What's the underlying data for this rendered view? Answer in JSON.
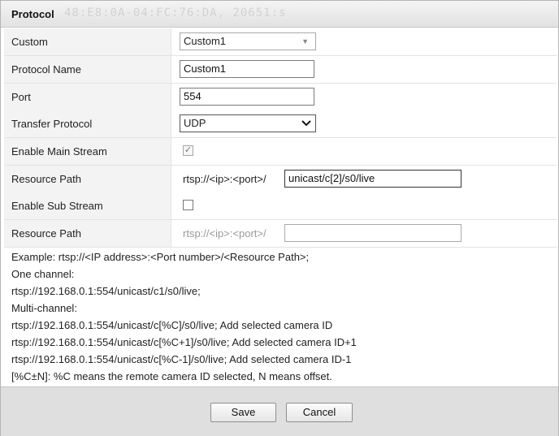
{
  "dialog": {
    "title": "Protocol",
    "background_text": "48:E8:0A-04:FC:76:DA, 20651:s"
  },
  "form": {
    "custom": {
      "label": "Custom",
      "value": "Custom1"
    },
    "protocol_name": {
      "label": "Protocol Name",
      "value": "Custom1"
    },
    "port": {
      "label": "Port",
      "value": "554"
    },
    "transfer_protocol": {
      "label": "Transfer Protocol",
      "value": "UDP"
    },
    "enable_main_stream": {
      "label": "Enable Main Stream",
      "checked": true,
      "check_glyph": "✓"
    },
    "resource_path_main": {
      "label": "Resource Path",
      "prefix": "rtsp://<ip>:<port>/",
      "value": "unicast/c[2]/s0/live"
    },
    "enable_sub_stream": {
      "label": "Enable Sub Stream",
      "checked": false
    },
    "resource_path_sub": {
      "label": "Resource Path",
      "prefix": "rtsp://<ip>:<port>/",
      "value": ""
    }
  },
  "example_lines": [
    "Example:  rtsp://<IP address>:<Port number>/<Resource Path>;",
    "One channel:",
    "rtsp://192.168.0.1:554/unicast/c1/s0/live;",
    "Multi-channel:",
    "rtsp://192.168.0.1:554/unicast/c[%C]/s0/live;  Add selected camera ID",
    "rtsp://192.168.0.1:554/unicast/c[%C+1]/s0/live;  Add selected camera ID+1",
    "rtsp://192.168.0.1:554/unicast/c[%C-1]/s0/live;  Add selected camera ID-1",
    "[%C±N]:  %C means the remote camera ID selected, N means offset."
  ],
  "buttons": {
    "save": "Save",
    "cancel": "Cancel"
  },
  "icons": {
    "dropdown_light": "▼",
    "dropdown_dark": "▼"
  }
}
